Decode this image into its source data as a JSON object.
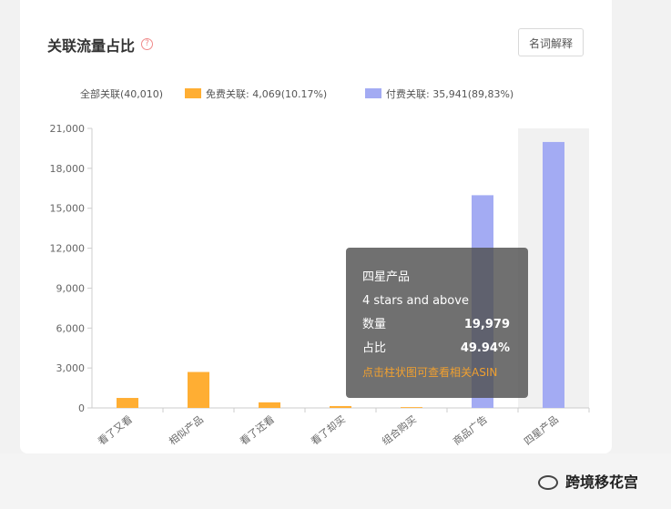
{
  "header": {
    "title": "关联流量占比",
    "help_icon": "question-circle-icon",
    "glossary_button": "名词解释"
  },
  "legend": {
    "all": "全部关联(40,010)",
    "free": "免费关联: 4,069(10.17%)",
    "paid": "付费关联: 35,941(89,83%)"
  },
  "colors": {
    "free": "#ffae33",
    "paid": "#a3abf3",
    "hover_band": "#f1f1f1",
    "tooltip_hint": "#f0a030"
  },
  "chart_data": {
    "type": "bar",
    "categories": [
      "看了又看",
      "相似产品",
      "看了还看",
      "看了却买",
      "组合购买",
      "商品广告",
      "四星产品"
    ],
    "series": [
      {
        "values": [
          750,
          2700,
          420,
          140,
          60,
          15980,
          19979
        ],
        "colors": [
          "free",
          "free",
          "free",
          "free",
          "free",
          "paid",
          "paid"
        ]
      }
    ],
    "ylim": [
      0,
      21000
    ],
    "yticks": [
      "0",
      "3,000",
      "6,000",
      "9,000",
      "12,000",
      "15,000",
      "18,000",
      "21,000"
    ],
    "highlighted_category": "四星产品"
  },
  "tooltip": {
    "title": "四星产品",
    "subtitle": "4 stars and above",
    "count_label": "数量",
    "count_value": "19,979",
    "share_label": "占比",
    "share_value": "49.94%",
    "hint": "点击柱状图可查看相关ASIN"
  },
  "watermark": {
    "text": "跨境移花宫",
    "icon": "wechat-icon"
  }
}
